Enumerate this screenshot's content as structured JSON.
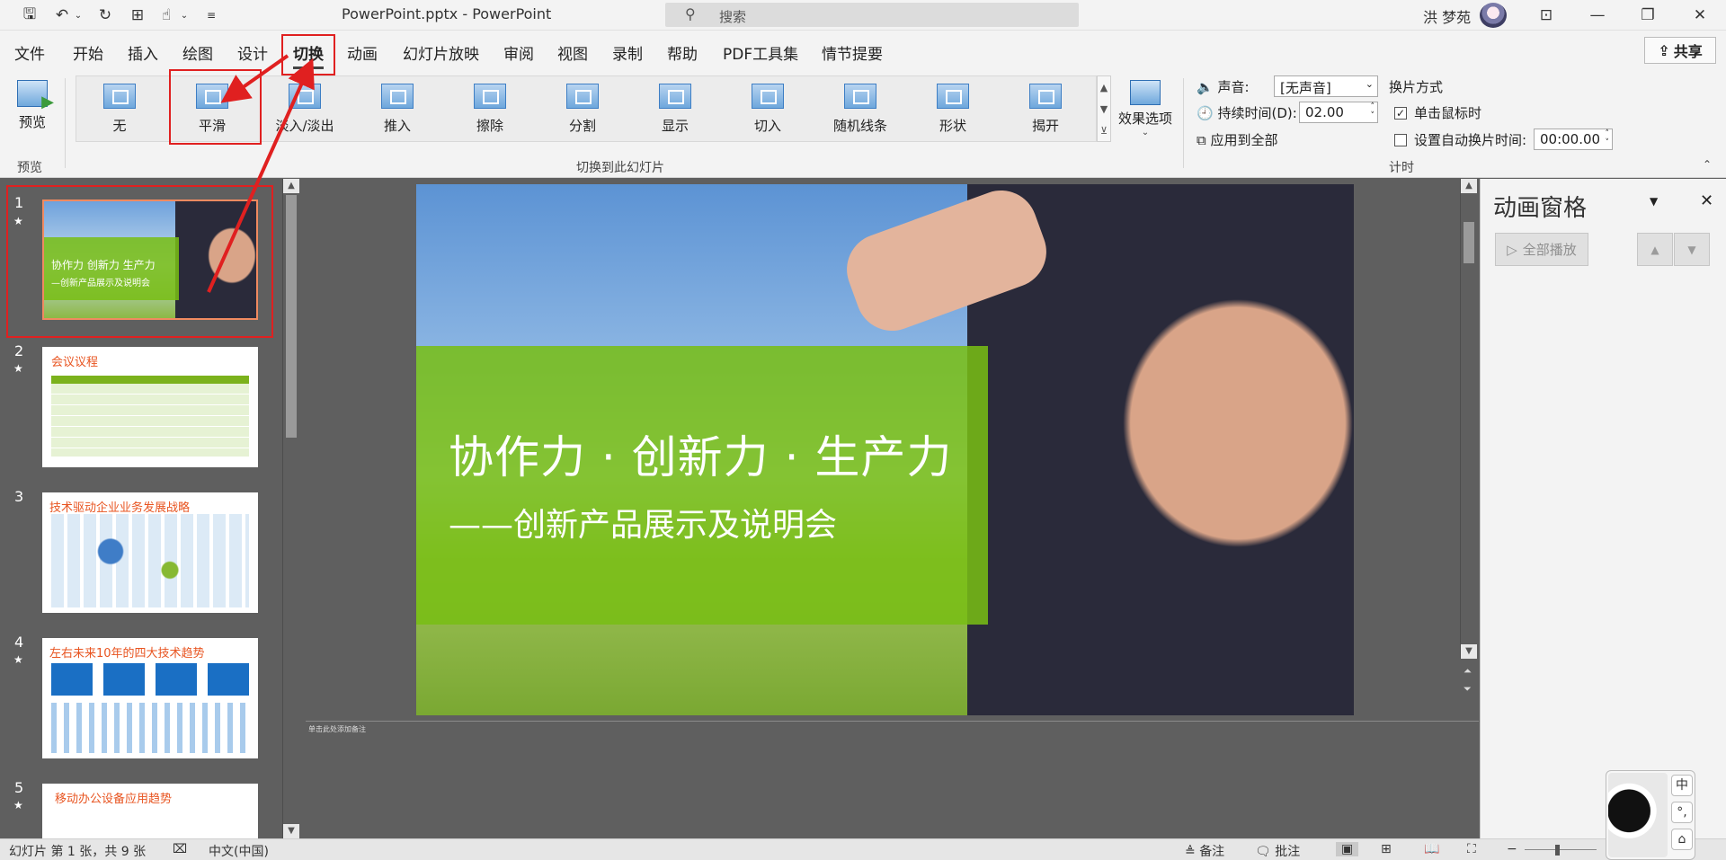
{
  "titlebar": {
    "doc_title": "PowerPoint.pptx  -  PowerPoint",
    "search_placeholder": "搜索",
    "user_name": "洪 梦苑"
  },
  "tabs": [
    "文件",
    "开始",
    "插入",
    "绘图",
    "设计",
    "切换",
    "动画",
    "幻灯片放映",
    "审阅",
    "视图",
    "录制",
    "帮助",
    "PDF工具集",
    "情节提要"
  ],
  "active_tab": "切换",
  "share_label": "共享",
  "ribbon": {
    "preview_label": "预览",
    "preview_group": "预览",
    "transitions": [
      {
        "label": "无"
      },
      {
        "label": "平滑"
      },
      {
        "label": "淡入/淡出"
      },
      {
        "label": "推入"
      },
      {
        "label": "擦除"
      },
      {
        "label": "分割"
      },
      {
        "label": "显示"
      },
      {
        "label": "切入"
      },
      {
        "label": "随机线条"
      },
      {
        "label": "形状"
      },
      {
        "label": "揭开"
      }
    ],
    "transitions_group": "切换到此幻灯片",
    "effect_options": "效果选项",
    "sound_label": "声音:",
    "sound_value": "[无声音]",
    "duration_label": "持续时间(D):",
    "duration_value": "02.00",
    "apply_all": "应用到全部",
    "advance_title": "换片方式",
    "on_click": "单击鼠标时",
    "on_click_checked": true,
    "auto_after": "设置自动换片时间:",
    "auto_after_checked": false,
    "auto_after_value": "00:00.00",
    "timing_group": "计时"
  },
  "thumbnails": [
    {
      "num": "1",
      "title": "",
      "line1": "协作力  创新力  生产力",
      "line2": "—创新产品展示及说明会"
    },
    {
      "num": "2",
      "title": "会议议程"
    },
    {
      "num": "3",
      "title": "技术驱动企业业务发展战略"
    },
    {
      "num": "4",
      "title": "左右未来10年的四大技术趋势"
    },
    {
      "num": "5",
      "title": "移动办公设备应用趋势"
    }
  ],
  "slide": {
    "title": "协作力 · 创新力 · 生产力",
    "subtitle": "——创新产品展示及说明会"
  },
  "notes_text": "单击此处添加备注",
  "anim_pane": {
    "title": "动画窗格",
    "play_all": "全部播放"
  },
  "statusbar": {
    "slide_info": "幻灯片 第 1 张，共 9 张",
    "language": "中文(中国)",
    "notes": "备注",
    "comments": "批注"
  },
  "ime_keys": [
    "中",
    "°,",
    "⌂"
  ]
}
